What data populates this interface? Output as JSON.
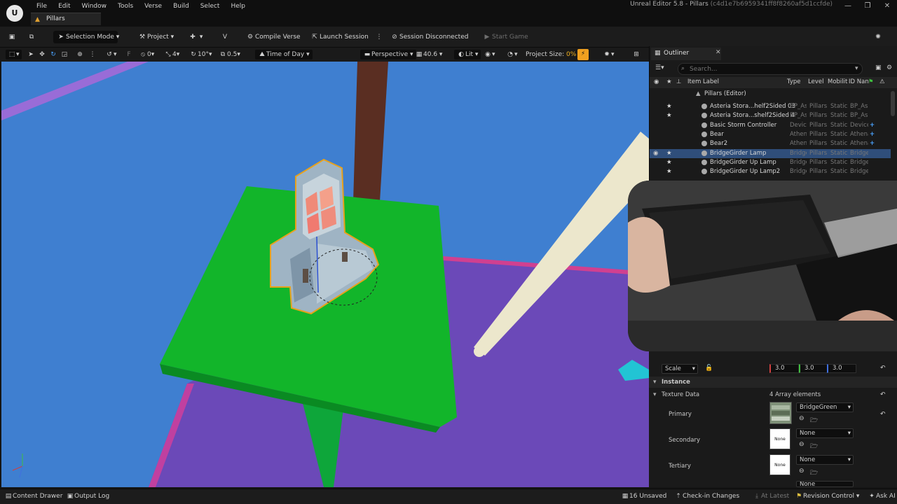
{
  "app": {
    "window_title": "Unreal Editor 5.8 - Pillars",
    "window_hash": "(c4d1e7b6959341ff8f8260af5d1ccfde)",
    "menu": [
      "File",
      "Edit",
      "Window",
      "Tools",
      "Verse",
      "Build",
      "Select",
      "Help"
    ],
    "doc_tab": "Pillars"
  },
  "toolbar": {
    "selection_mode": "Selection Mode",
    "project": "Project",
    "compile_verse": "Compile Verse",
    "launch_session": "Launch Session",
    "session_status": "Session Disconnected",
    "start_game": "Start Game"
  },
  "viewport_toolbar": {
    "rotation_snap": "0",
    "grid_snap": "4",
    "angle_snap": "10°",
    "scale_snap": "0.5",
    "time_of_day": "Time of Day",
    "perspective": "Perspective",
    "fov": "40.6",
    "lit": "Lit",
    "project_size_label": "Project Size:",
    "project_size_value": "0%"
  },
  "outliner": {
    "tab_label": "Outliner",
    "search_placeholder": "Search...",
    "columns": {
      "label": "Item Label",
      "type": "Type",
      "level": "Level",
      "mobility": "Mobilit",
      "id": "ID Nan"
    },
    "root": "Pillars (Editor)",
    "rows": [
      {
        "label": "Asteria Stora...helf2Sided 03",
        "type": "BP_As",
        "level": "Pillars",
        "mobility": "Static",
        "id": "BP_As",
        "star": true,
        "add": false
      },
      {
        "label": "Asteria Stora...shelf2Sided 4",
        "type": "BP_As",
        "level": "Pillars",
        "mobility": "Static",
        "id": "BP_As",
        "star": true,
        "add": false
      },
      {
        "label": "Basic Storm Controller",
        "type": "Device",
        "level": "Pillars",
        "mobility": "Static",
        "id": "Device",
        "star": false,
        "add": true
      },
      {
        "label": "Bear",
        "type": "Athena",
        "level": "Pillars",
        "mobility": "Static",
        "id": "Athena",
        "star": false,
        "add": true
      },
      {
        "label": "Bear2",
        "type": "Athena",
        "level": "Pillars",
        "mobility": "Static",
        "id": "Athena",
        "star": false,
        "add": true
      },
      {
        "label": "BridgeGirder Lamp",
        "type": "Bridge",
        "level": "Pillars",
        "mobility": "Static",
        "id": "Bridge",
        "star": true,
        "add": false,
        "selected": true
      },
      {
        "label": "BridgeGirder Up Lamp",
        "type": "Bridge",
        "level": "Pillars",
        "mobility": "Static",
        "id": "Bridge",
        "star": true,
        "add": false
      },
      {
        "label": "BridgeGirder Up Lamp2",
        "type": "Bridge",
        "level": "Pillars",
        "mobility": "Static",
        "id": "Bridge",
        "star": true,
        "add": false
      }
    ]
  },
  "details": {
    "scale_label": "Scale",
    "scale_x": "3.0",
    "scale_y": "3.0",
    "scale_z": "3.0",
    "section_instance": "Instance",
    "texture_data_label": "Texture Data",
    "texture_data_value": "4 Array elements",
    "primary_label": "Primary",
    "primary_value": "BridgeGreen",
    "secondary_label": "Secondary",
    "secondary_value": "None",
    "tertiary_label": "Tertiary",
    "tertiary_value": "None",
    "fourth_value": "None",
    "thumb_none": "None"
  },
  "statusbar": {
    "content_drawer": "Content Drawer",
    "output_log": "Output Log",
    "unsaved": "16 Unsaved",
    "check_in": "Check-in Changes",
    "at_latest": "At Latest",
    "revision_control": "Revision Control",
    "ask_ai": "Ask AI"
  },
  "colors": {
    "viewport_sky": "#3f7fd0",
    "platform_green": "#12b52a",
    "floor_purple": "#6b49b8",
    "selection_outline": "#e8a21c",
    "accent_orange": "#f0a020",
    "selection_row": "#2f4e7a"
  }
}
